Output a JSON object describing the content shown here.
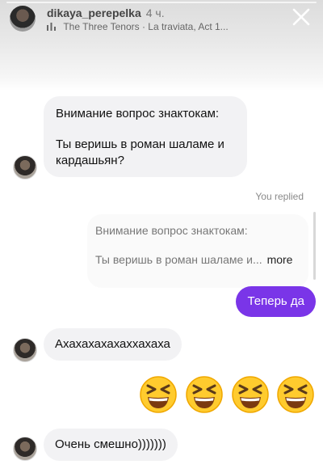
{
  "story": {
    "username": "dikaya_perepelka",
    "time": "4 ч.",
    "music": "The Three Tenors · La traviata, Act 1..."
  },
  "thread": {
    "question_line1": "Внимание вопрос знактокам:",
    "question_line2": "Ты веришь в роман шаламе и кардашьян?",
    "replied_note": "You replied",
    "quote_line1": "Внимание вопрос знактокам:",
    "quote_line2": "Ты веришь в роман шаламе и...",
    "quote_more": "more",
    "my_reply": "Теперь да",
    "laugh_message": "Ахахахахахаххахаха",
    "emoji": [
      "grinning-squinting-face",
      "grinning-squinting-face",
      "grinning-squinting-face",
      "grinning-squinting-face"
    ],
    "funny_message": "Очень смешно)))))))"
  },
  "colors": {
    "outgoing_bubble": "#7a35e8",
    "incoming_bubble": "#f2f2f4"
  }
}
